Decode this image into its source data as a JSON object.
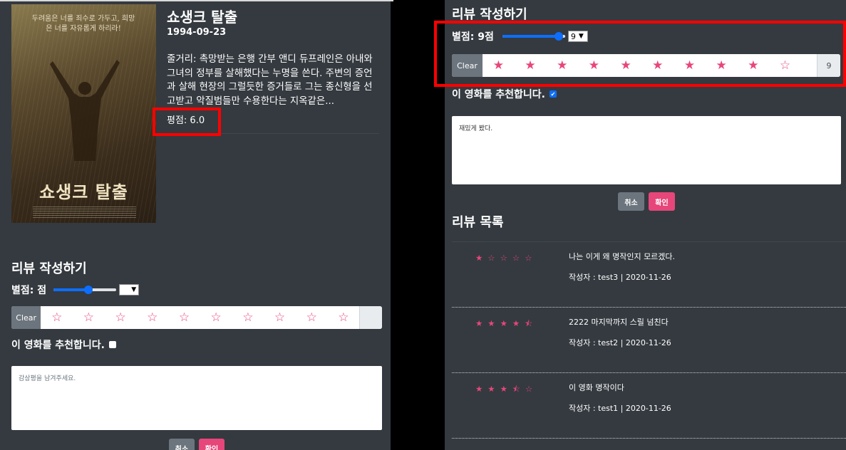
{
  "movie": {
    "title": "쇼생크 탈출",
    "date": "1994-09-23",
    "plot": "줄거리: 촉망받는 은행 간부 앤디 듀프레인은 아내와 그녀의 정부를 살해했다는 누명을 쓴다. 주변의 증언과 살해 현장의 그럴듯한 증거들로 그는 종신형을 선고받고 악질범들만 수용한다는 지옥같은...",
    "rating": "평점: 6.0",
    "poster": {
      "tagline": "두려움은 너를 죄수로 가두고, 희망은 너를 자유롭게 하리라!",
      "title": "쇼생크 탈출"
    }
  },
  "review_form_left": {
    "heading": "리뷰 작성하기",
    "score_label": "별점: 점",
    "slider_value": 0.55,
    "select_value": "",
    "clear_label": "Clear",
    "stars": [
      "☆",
      "☆",
      "☆",
      "☆",
      "☆",
      "☆",
      "☆",
      "☆",
      "☆",
      "☆"
    ],
    "count": "",
    "recommend_label": "이 영화를 추천합니다.",
    "recommend_checked": false,
    "textarea_placeholder": "감상평을 남겨주세요.",
    "cancel_label": "취소",
    "ok_label": "확인"
  },
  "review_form_right": {
    "heading": "리뷰 작성하기",
    "score_label": "별점: 9점",
    "slider_value": 0.9,
    "select_value": "9",
    "clear_label": "Clear",
    "stars": [
      "★",
      "★",
      "★",
      "★",
      "★",
      "★",
      "★",
      "★",
      "★",
      "☆"
    ],
    "count": "9",
    "recommend_label": "이 영화를 추천합니다.",
    "recommend_checked": true,
    "textarea_value": "재밌게 봤다.",
    "cancel_label": "취소",
    "ok_label": "확인"
  },
  "review_list": {
    "heading": "리뷰 목록",
    "items": [
      {
        "stars": "★☆☆☆☆",
        "text": "나는 이게 왜 명작인지 모르겠다.",
        "author": "작성자 : test3 | 2020-11-26"
      },
      {
        "stars": "★★★★⯪",
        "text": "2222 마지막까지 스릴 넘친다",
        "author": "작성자 : test2 | 2020-11-26"
      },
      {
        "stars": "★★★⯪☆",
        "text": "이 영화 명작이다",
        "author": "작성자 : test1 | 2020-11-26"
      }
    ]
  },
  "colors": {
    "panel": "#343a40",
    "accent_pink": "#e7467a",
    "slider_blue": "#0d6efd",
    "highlight_red": "#ff0000"
  }
}
